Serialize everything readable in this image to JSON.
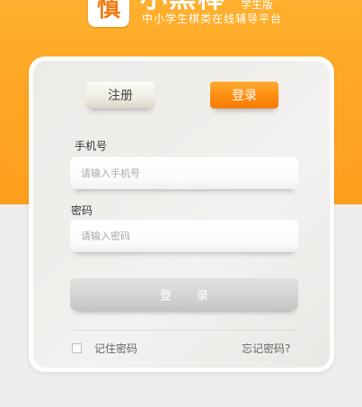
{
  "header": {
    "logo_glyph": "慎",
    "brand_title": "小黑棒",
    "edition": "学生版",
    "slogan": "中小学生棋类在线辅导平台"
  },
  "tabs": {
    "register_label": "注册",
    "login_label": "登录"
  },
  "form": {
    "phone_label": "手机号",
    "phone_placeholder": "请输入手机号",
    "password_label": "密码",
    "password_placeholder": "请输入密码",
    "submit_label": "登 录",
    "remember_label": "记住密码",
    "forgot_label": "忘记密码?"
  },
  "colors": {
    "accent": "#ff9a1a",
    "header_bg": "#ffa826"
  }
}
